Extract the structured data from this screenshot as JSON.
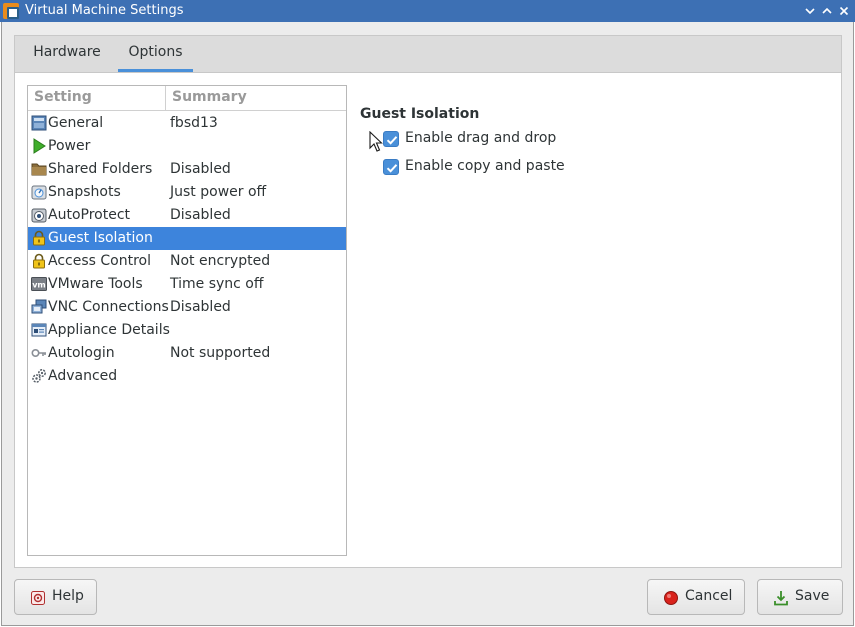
{
  "window": {
    "title": "Virtual Machine Settings"
  },
  "tabs": [
    {
      "label": "Hardware",
      "active": false
    },
    {
      "label": "Options",
      "active": true
    }
  ],
  "settings_list": {
    "header_setting": "Setting",
    "header_summary": "Summary",
    "selected_index": 5,
    "items": [
      {
        "label": "General",
        "summary": "fbsd13",
        "icon": "general-icon"
      },
      {
        "label": "Power",
        "summary": "",
        "icon": "power-icon"
      },
      {
        "label": "Shared Folders",
        "summary": "Disabled",
        "icon": "folder-icon"
      },
      {
        "label": "Snapshots",
        "summary": "Just power off",
        "icon": "snapshot-icon"
      },
      {
        "label": "AutoProtect",
        "summary": "Disabled",
        "icon": "autoprotect-icon"
      },
      {
        "label": "Guest Isolation",
        "summary": "",
        "icon": "lock-icon"
      },
      {
        "label": "Access Control",
        "summary": "Not encrypted",
        "icon": "lock-icon"
      },
      {
        "label": "VMware Tools",
        "summary": "Time sync off",
        "icon": "vm-icon"
      },
      {
        "label": "VNC Connections",
        "summary": "Disabled",
        "icon": "vnc-icon"
      },
      {
        "label": "Appliance Details",
        "summary": "",
        "icon": "appliance-icon"
      },
      {
        "label": "Autologin",
        "summary": "Not supported",
        "icon": "key-icon"
      },
      {
        "label": "Advanced",
        "summary": "",
        "icon": "gears-icon"
      }
    ]
  },
  "guest_isolation": {
    "title": "Guest Isolation",
    "options": [
      {
        "label": "Enable drag and drop",
        "checked": true
      },
      {
        "label": "Enable copy and paste",
        "checked": true
      }
    ]
  },
  "buttons": {
    "help": "Help",
    "cancel": "Cancel",
    "save": "Save"
  },
  "colors": {
    "titlebar": "#3d70b4",
    "selection": "#3d84dc",
    "accent": "#4a90d9"
  }
}
